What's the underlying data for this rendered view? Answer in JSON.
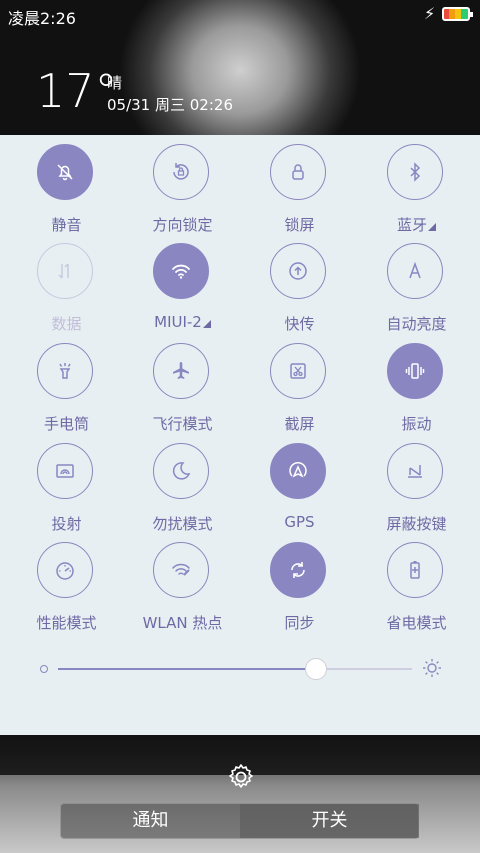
{
  "status_bar": {
    "time": "凌晨2:26"
  },
  "weather": {
    "temperature": "17°",
    "condition": "晴",
    "datetime": "05/31 周三 02:26"
  },
  "toggles": [
    {
      "label": "静音",
      "icon": "bell-muted-icon",
      "on": true,
      "dim": false
    },
    {
      "label": "方向锁定",
      "icon": "rotation-lock-icon",
      "on": false,
      "dim": false
    },
    {
      "label": "锁屏",
      "icon": "lock-icon",
      "on": false,
      "dim": false
    },
    {
      "label": "蓝牙",
      "icon": "bluetooth-icon",
      "on": false,
      "dim": false,
      "more": true
    },
    {
      "label": "数据",
      "icon": "mobile-data-icon",
      "on": false,
      "dim": true
    },
    {
      "label": "MIUI-2",
      "icon": "wifi-icon",
      "on": true,
      "dim": false,
      "more": true
    },
    {
      "label": "快传",
      "icon": "transfer-icon",
      "on": false,
      "dim": false
    },
    {
      "label": "自动亮度",
      "icon": "auto-brightness-icon",
      "on": false,
      "dim": false
    },
    {
      "label": "手电筒",
      "icon": "flashlight-icon",
      "on": false,
      "dim": false
    },
    {
      "label": "飞行模式",
      "icon": "airplane-icon",
      "on": false,
      "dim": false
    },
    {
      "label": "截屏",
      "icon": "screenshot-icon",
      "on": false,
      "dim": false
    },
    {
      "label": "振动",
      "icon": "vibrate-icon",
      "on": true,
      "dim": false
    },
    {
      "label": "投射",
      "icon": "cast-icon",
      "on": false,
      "dim": false
    },
    {
      "label": "勿扰模式",
      "icon": "moon-icon",
      "on": false,
      "dim": false
    },
    {
      "label": "GPS",
      "icon": "gps-icon",
      "on": true,
      "dim": false
    },
    {
      "label": "屏蔽按键",
      "icon": "block-keys-icon",
      "on": false,
      "dim": false
    },
    {
      "label": "性能模式",
      "icon": "speedometer-icon",
      "on": false,
      "dim": false
    },
    {
      "label": "WLAN 热点",
      "icon": "hotspot-icon",
      "on": false,
      "dim": false
    },
    {
      "label": "同步",
      "icon": "sync-icon",
      "on": true,
      "dim": false
    },
    {
      "label": "省电模式",
      "icon": "battery-saver-icon",
      "on": false,
      "dim": false
    }
  ],
  "brightness": {
    "level": 0.73
  },
  "bottom": {
    "tab_notify": "通知",
    "tab_toggles": "开关"
  },
  "colors": {
    "accent": "#8a86c2",
    "label": "#6f6aa4",
    "panel": "#e8eff3"
  }
}
